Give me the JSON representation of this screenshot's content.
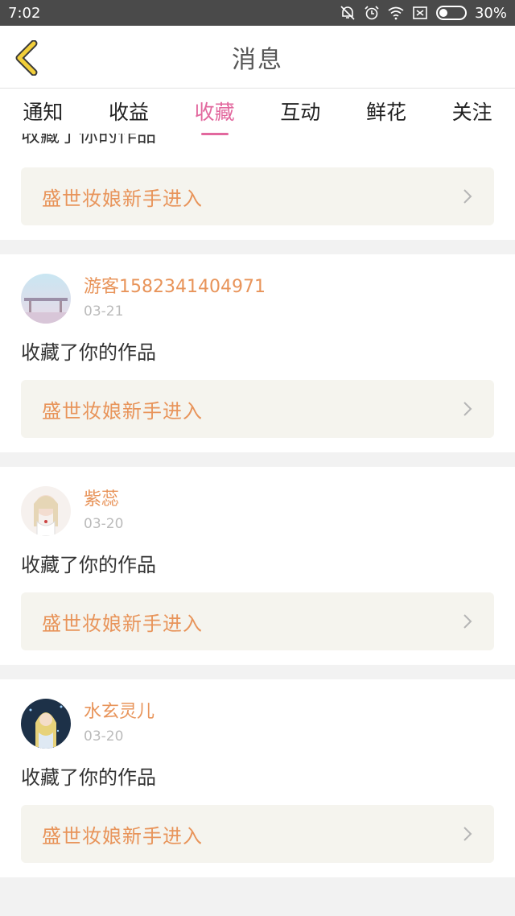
{
  "status_bar": {
    "time": "7:02",
    "battery": "30%"
  },
  "nav": {
    "title": "消息"
  },
  "tabs": [
    {
      "label": "通知"
    },
    {
      "label": "收益"
    },
    {
      "label": "收藏"
    },
    {
      "label": "互动"
    },
    {
      "label": "鲜花"
    },
    {
      "label": "关注"
    }
  ],
  "feed": {
    "first": {
      "action": "收藏了你的作品",
      "link": "盛世妆娘新手进入"
    },
    "items": [
      {
        "username": "游客1582341404971",
        "date": "03-21",
        "action": "收藏了你的作品",
        "link": "盛世妆娘新手进入"
      },
      {
        "username": "紫蕊",
        "date": "03-20",
        "action": "收藏了你的作品",
        "link": "盛世妆娘新手进入"
      },
      {
        "username": "水玄灵儿",
        "date": "03-20",
        "action": "收藏了你的作品",
        "link": "盛世妆娘新手进入"
      }
    ]
  },
  "colors": {
    "accent": "#e2689e",
    "username": "#e8945a",
    "back_icon": "#f2cf3a"
  }
}
